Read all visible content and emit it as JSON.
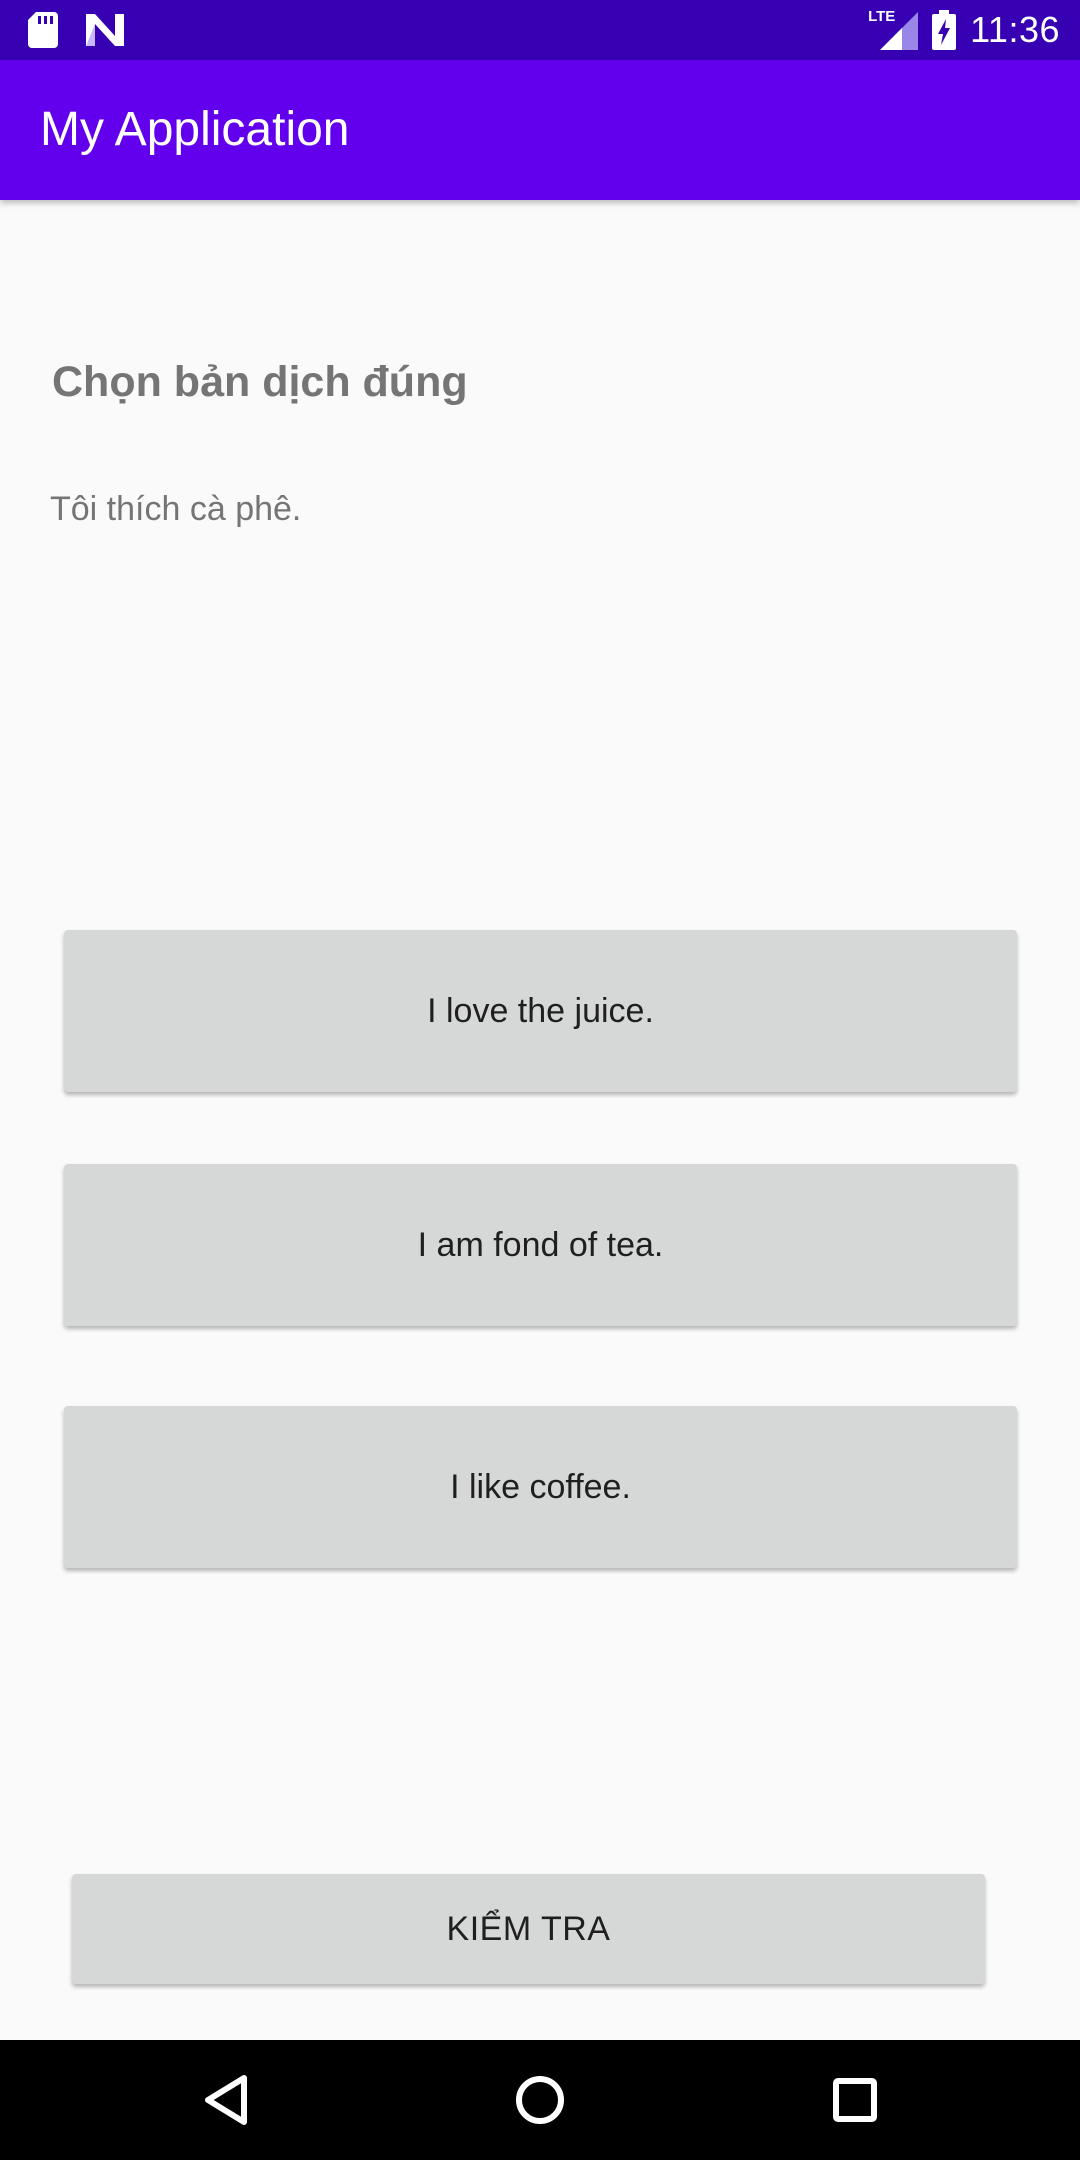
{
  "status_bar": {
    "time": "11:36",
    "network_label": "LTE",
    "icons": [
      "sd-card-icon",
      "n-logo-icon",
      "lte-signal-icon",
      "battery-charging-icon"
    ]
  },
  "app_bar": {
    "title": "My Application"
  },
  "question": {
    "heading": "Chọn bản dịch đúng",
    "sentence": "Tôi thích cà phê."
  },
  "answers": [
    {
      "label": "I love the juice."
    },
    {
      "label": "I am fond of tea."
    },
    {
      "label": "I like coffee."
    }
  ],
  "check_button": {
    "label": "KIỂM TRA"
  },
  "nav_bar": {
    "icons": [
      "back-icon",
      "home-icon",
      "recents-icon"
    ]
  },
  "colors": {
    "status_bar": "#3700b3",
    "app_bar": "#6200ee",
    "background": "#fafafa",
    "button": "#d6d7d7",
    "secondary_text": "#757575",
    "nav_bar": "#000000"
  }
}
